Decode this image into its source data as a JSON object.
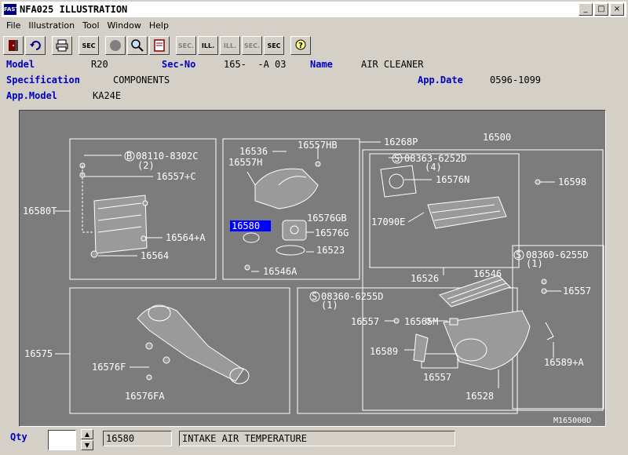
{
  "window": {
    "title": "NFA025 ILLUSTRATION",
    "app_icon_text": "FAST",
    "minimize_icon": "minimize-icon",
    "maximize_icon": "maximize-icon",
    "close_icon": "close-icon"
  },
  "menu": [
    "File",
    "Illustration",
    "Tool",
    "Window",
    "Help"
  ],
  "toolbar": {
    "sec_label": "SEC",
    "sec_prev_label": "SEC.",
    "ill_label": "ILL.",
    "ill_dis_label": "ILL.",
    "sec_dis_label": "SEC.",
    "sec_next_label": "SEC",
    "help_label": "?"
  },
  "header": {
    "model_label": "Model",
    "model_value": "R20",
    "secno_label": "Sec-No",
    "secno_value": "165-  -A 03",
    "name_label": "Name",
    "name_value": "AIR CLEANER",
    "spec_label": "Specification",
    "spec_value": "COMPONENTS",
    "appdate_label": "App.Date",
    "appdate_value": "0596-1099",
    "appmodel_label": "App.Model",
    "appmodel_value": "KA24E"
  },
  "diagram": {
    "labels": {
      "p16580T": "16580T",
      "p08110": "08110-8302C",
      "p08110q": "(2)",
      "p16557c": "16557+C",
      "p16564a": "16564+A",
      "p16564": "16564",
      "p16536": "16536",
      "p16557h": "16557H",
      "p16557hb": "16557HB",
      "p16576gb": "16576GB",
      "p16580": "16580",
      "p16576g": "16576G",
      "p16523": "16523",
      "p16546a": "16546A",
      "p16268p": "16268P",
      "p16500": "16500",
      "p08363": "08363-6252D",
      "p08363q": "(4)",
      "p16576n": "16576N",
      "p17090e": "17090E",
      "p16598": "16598",
      "p16526": "16526",
      "p08360a": "08360-6255D",
      "p08360aq": "(1)",
      "p16546": "16546",
      "p16557r": "16557",
      "p08360b": "08360-6255D",
      "p08360bq": "(1)",
      "p16575": "16575",
      "p16576f": "16576F",
      "p16576fa": "16576FA",
      "p16557l": "16557",
      "p16565m": "16565M",
      "p16589": "16589",
      "p16589a": "16589+A",
      "p16557b": "16557",
      "p16528": "16528",
      "footer_code": "M165000D",
      "bolt_b": "B",
      "bolt_s": "S"
    }
  },
  "bottom": {
    "qty_label": "Qty",
    "qty_value": "",
    "part_no": "16580",
    "part_name": "INTAKE AIR TEMPERATURE",
    "spin_up": "▲",
    "spin_down": "▼"
  }
}
